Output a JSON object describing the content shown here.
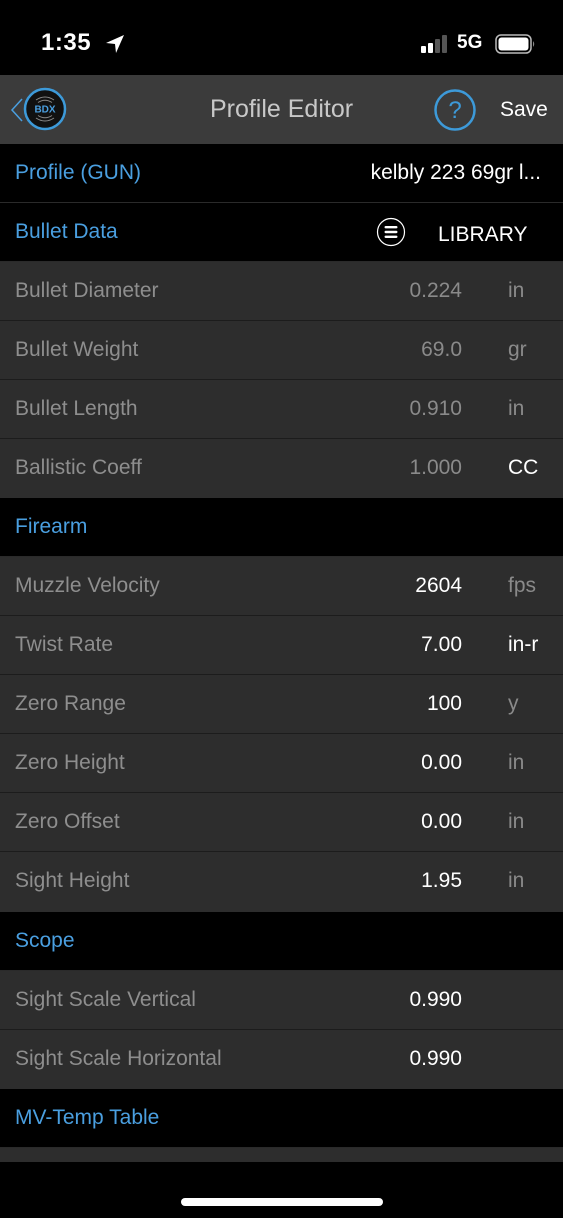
{
  "status_bar": {
    "time": "1:35",
    "network": "5G",
    "icons": [
      "location-arrow-icon",
      "signal-icon",
      "battery-icon"
    ]
  },
  "nav": {
    "title": "Profile Editor",
    "logo_text": "BDX",
    "save_label": "Save",
    "help_glyph": "?",
    "accent_color": "#3d9ad9"
  },
  "profile": {
    "label": "Profile (GUN)",
    "value": "kelbly 223 69gr l..."
  },
  "bullet_data": {
    "label": "Bullet Data",
    "library_label": "LIBRARY",
    "rows": [
      {
        "label": "Bullet Diameter",
        "value": "0.224",
        "unit": "in"
      },
      {
        "label": "Bullet Weight",
        "value": "69.0",
        "unit": "gr"
      },
      {
        "label": "Bullet Length",
        "value": "0.910",
        "unit": "in"
      },
      {
        "label": "Ballistic Coeff",
        "value": "1.000",
        "unit": "CC"
      }
    ]
  },
  "firearm": {
    "label": "Firearm",
    "rows": [
      {
        "label": "Muzzle Velocity",
        "value": "2604",
        "unit": "fps"
      },
      {
        "label": "Twist Rate",
        "value": "7.00",
        "unit": "in-r"
      },
      {
        "label": "Zero Range",
        "value": "100",
        "unit": "y"
      },
      {
        "label": "Zero Height",
        "value": "0.00",
        "unit": "in"
      },
      {
        "label": "Zero Offset",
        "value": "0.00",
        "unit": "in"
      },
      {
        "label": "Sight Height",
        "value": "1.95",
        "unit": "in"
      }
    ]
  },
  "scope": {
    "label": "Scope",
    "rows": [
      {
        "label": "Sight Scale Vertical",
        "value": "0.990"
      },
      {
        "label": "Sight Scale Horizontal",
        "value": "0.990"
      }
    ]
  },
  "mv_temp": {
    "label": "MV-Temp Table"
  },
  "colors": {
    "section_header": "#4a9fe0",
    "row_bg": "#2d2d2d",
    "nav_bg": "#3b3b3b"
  }
}
